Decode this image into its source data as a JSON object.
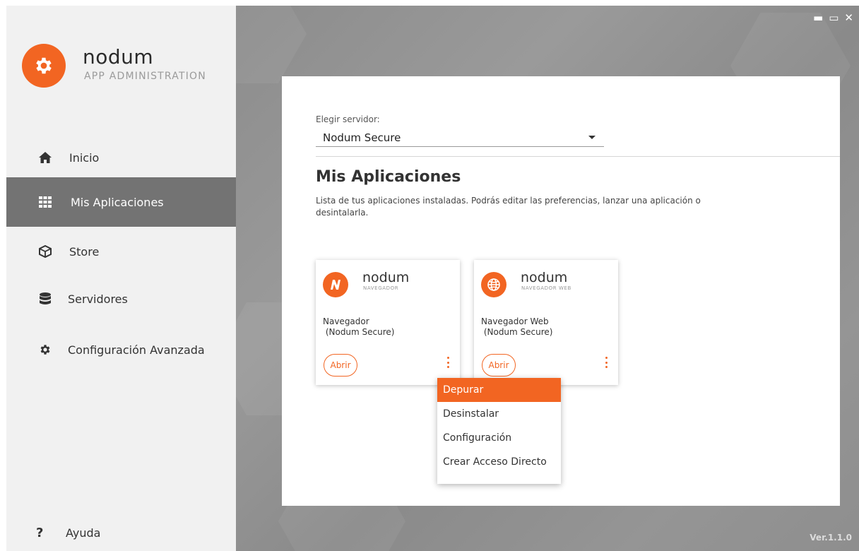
{
  "app": {
    "brand": "nodum",
    "subtitle": "APP ADMINISTRATION",
    "accent": "#f26522"
  },
  "window_controls": {
    "minimize": "▬",
    "maximize": "▭",
    "close": "✕"
  },
  "sidebar": {
    "items": [
      {
        "label": "Inicio",
        "icon": "home-icon"
      },
      {
        "label": "Mis Aplicaciones",
        "icon": "grid-icon",
        "active": true
      },
      {
        "label": "Store",
        "icon": "box-icon"
      },
      {
        "label": "Servidores",
        "icon": "database-icon"
      },
      {
        "label": "Configuración Avanzada",
        "icon": "gear-icon"
      }
    ],
    "help": {
      "label": "Ayuda",
      "icon": "?"
    }
  },
  "server": {
    "label": "Elegir servidor:",
    "selected": "Nodum Secure"
  },
  "main": {
    "title": "Mis Aplicaciones",
    "description": "Lista de tus aplicaciones instaladas. Podrás editar las preferencias, lanzar una aplicación o desintalarla."
  },
  "apps": [
    {
      "brand": "nodum",
      "sub": "NAVEGADOR",
      "name": "Navegador\n (Nodum Secure)",
      "open_label": "Abrir",
      "icon": "nodum-n-icon"
    },
    {
      "brand": "nodum",
      "sub": "NAVEGADOR WEB",
      "name": "Navegador Web\n (Nodum Secure)",
      "open_label": "Abrir",
      "icon": "globe-icon"
    }
  ],
  "context_menu": {
    "items": [
      {
        "label": "Depurar",
        "selected": true
      },
      {
        "label": "Desinstalar"
      },
      {
        "label": "Configuración"
      },
      {
        "label": "Crear Acceso Directo"
      }
    ]
  },
  "version": "Ver.1.1.0"
}
